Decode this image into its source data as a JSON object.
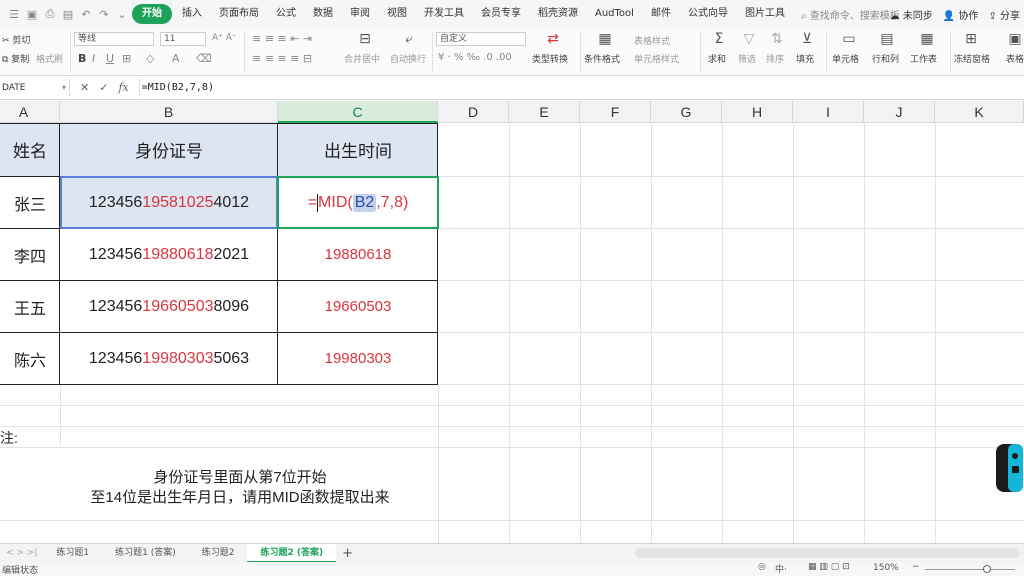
{
  "menu": {
    "tabs": [
      "开始",
      "插入",
      "页面布局",
      "公式",
      "数据",
      "审阅",
      "视图",
      "开发工具",
      "会员专享",
      "稻壳资源",
      "AudTool",
      "邮件",
      "公式向导",
      "图片工具"
    ],
    "active_tab": "开始",
    "search": "查找命令、搜索模板",
    "right": [
      "未同步",
      "协作",
      "分享"
    ]
  },
  "ribbon": {
    "cut": "剪切",
    "copy": "复制",
    "format_painter": "格式刷",
    "font_name": "等线",
    "font_size": "11",
    "number_format": "自定义",
    "merge": "合并居中",
    "wrap": "自动换行",
    "type_convert": "类型转换",
    "cond_format": "条件格式",
    "table_style": "表格样式",
    "cell_style": "单元格样式",
    "sum": "求和",
    "filter": "筛选",
    "sort": "排序",
    "fill": "填充",
    "cell": "单元格",
    "rowcol": "行和列",
    "sheet": "工作表",
    "freeze": "冻结窗格",
    "table_tools": "表格"
  },
  "formula_bar": {
    "name_box": "DATE",
    "formula": "=MID(B2,7,8)"
  },
  "columns": [
    "A",
    "B",
    "C",
    "D",
    "E",
    "F",
    "G",
    "H",
    "I",
    "J",
    "K"
  ],
  "table": {
    "headers": [
      "姓名",
      "身份证号",
      "出生时间"
    ],
    "rows": [
      {
        "name": "张三",
        "id_pre": "123456",
        "id_mid": "19581025",
        "id_post": "4012",
        "birth": "=MID(B2,7,8)"
      },
      {
        "name": "李四",
        "id_pre": "123456",
        "id_mid": "19880618",
        "id_post": "2021",
        "birth": "19880618"
      },
      {
        "name": "王五",
        "id_pre": "123456",
        "id_mid": "19660503",
        "id_post": "8096",
        "birth": "19660503"
      },
      {
        "name": "陈六",
        "id_pre": "123456",
        "id_mid": "19980303",
        "id_post": "5063",
        "birth": "19980303"
      }
    ],
    "edit_parts": {
      "eq": "=",
      "fn": "MID(",
      "ref": "B2",
      "rest": ",7,8)"
    }
  },
  "note": {
    "label": "注:",
    "line1": "身份证号里面从第7位开始",
    "line2": "至14位是出生年月日，请用MID函数提取出来"
  },
  "sheets": [
    "练习题1",
    "练习题1 (答案)",
    "练习题2",
    "练习题2 (答案)"
  ],
  "active_sheet": "练习题2 (答案)",
  "status": {
    "left": "编辑状态",
    "zoom": "150%"
  },
  "colors": {
    "accent": "#1fa35a",
    "header_fill": "#dde4f2",
    "highlight_red": "#d9363e"
  }
}
